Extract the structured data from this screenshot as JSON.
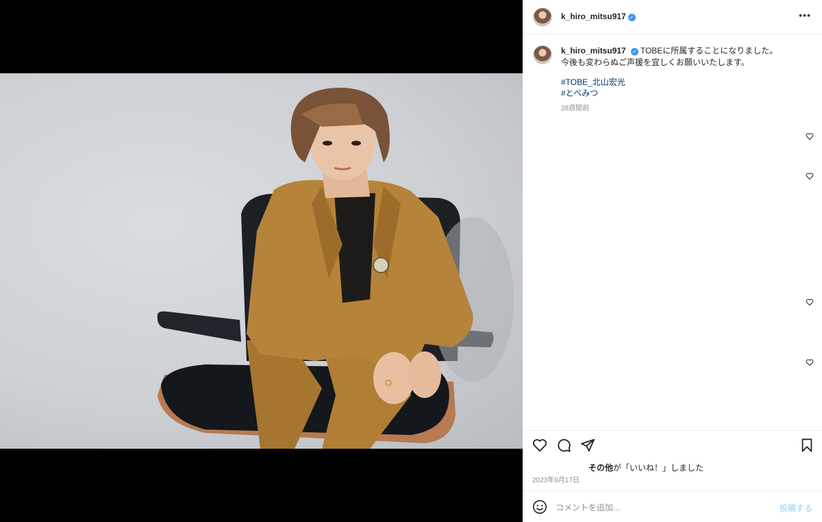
{
  "post": {
    "username": "k_hiro_mitsu917",
    "verified_mark": "✓",
    "more_icon": "•••",
    "caption_lines": [
      "TOBEに所属することになりました。",
      "今後も変わらぬご声援を宜しくお願いいたします。"
    ],
    "hashtags": [
      "#TOBE_北山宏光",
      "#とべみつ"
    ],
    "relative_time": "28週間前",
    "likes_suffix_bold": "その他",
    "likes_suffix": "が「いいね！」しました",
    "date": "2023年9月17日",
    "comment_placeholder": "コメントを追加...",
    "post_button": "投稿する"
  },
  "colors": {
    "link": "#00376b",
    "verified": "#3897f0",
    "secondary_text": "#8e8e8e",
    "post_button_disabled": "#b2dffc"
  },
  "icons": {
    "like": "heart-icon",
    "comment": "comment-icon",
    "share": "paper-plane-icon",
    "save": "bookmark-icon",
    "emoji": "smiley-icon",
    "more": "more-horizontal-icon"
  }
}
